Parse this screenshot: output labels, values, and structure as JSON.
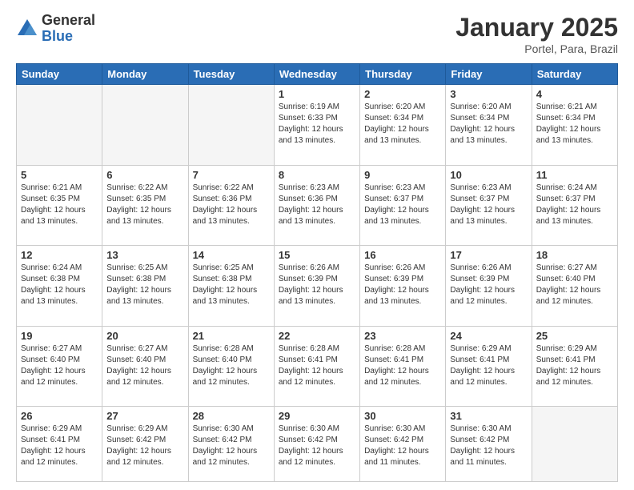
{
  "header": {
    "logo_general": "General",
    "logo_blue": "Blue",
    "month_title": "January 2025",
    "location": "Portel, Para, Brazil"
  },
  "weekdays": [
    "Sunday",
    "Monday",
    "Tuesday",
    "Wednesday",
    "Thursday",
    "Friday",
    "Saturday"
  ],
  "weeks": [
    [
      {
        "day": "",
        "info": ""
      },
      {
        "day": "",
        "info": ""
      },
      {
        "day": "",
        "info": ""
      },
      {
        "day": "1",
        "info": "Sunrise: 6:19 AM\nSunset: 6:33 PM\nDaylight: 12 hours\nand 13 minutes."
      },
      {
        "day": "2",
        "info": "Sunrise: 6:20 AM\nSunset: 6:34 PM\nDaylight: 12 hours\nand 13 minutes."
      },
      {
        "day": "3",
        "info": "Sunrise: 6:20 AM\nSunset: 6:34 PM\nDaylight: 12 hours\nand 13 minutes."
      },
      {
        "day": "4",
        "info": "Sunrise: 6:21 AM\nSunset: 6:34 PM\nDaylight: 12 hours\nand 13 minutes."
      }
    ],
    [
      {
        "day": "5",
        "info": "Sunrise: 6:21 AM\nSunset: 6:35 PM\nDaylight: 12 hours\nand 13 minutes."
      },
      {
        "day": "6",
        "info": "Sunrise: 6:22 AM\nSunset: 6:35 PM\nDaylight: 12 hours\nand 13 minutes."
      },
      {
        "day": "7",
        "info": "Sunrise: 6:22 AM\nSunset: 6:36 PM\nDaylight: 12 hours\nand 13 minutes."
      },
      {
        "day": "8",
        "info": "Sunrise: 6:23 AM\nSunset: 6:36 PM\nDaylight: 12 hours\nand 13 minutes."
      },
      {
        "day": "9",
        "info": "Sunrise: 6:23 AM\nSunset: 6:37 PM\nDaylight: 12 hours\nand 13 minutes."
      },
      {
        "day": "10",
        "info": "Sunrise: 6:23 AM\nSunset: 6:37 PM\nDaylight: 12 hours\nand 13 minutes."
      },
      {
        "day": "11",
        "info": "Sunrise: 6:24 AM\nSunset: 6:37 PM\nDaylight: 12 hours\nand 13 minutes."
      }
    ],
    [
      {
        "day": "12",
        "info": "Sunrise: 6:24 AM\nSunset: 6:38 PM\nDaylight: 12 hours\nand 13 minutes."
      },
      {
        "day": "13",
        "info": "Sunrise: 6:25 AM\nSunset: 6:38 PM\nDaylight: 12 hours\nand 13 minutes."
      },
      {
        "day": "14",
        "info": "Sunrise: 6:25 AM\nSunset: 6:38 PM\nDaylight: 12 hours\nand 13 minutes."
      },
      {
        "day": "15",
        "info": "Sunrise: 6:26 AM\nSunset: 6:39 PM\nDaylight: 12 hours\nand 13 minutes."
      },
      {
        "day": "16",
        "info": "Sunrise: 6:26 AM\nSunset: 6:39 PM\nDaylight: 12 hours\nand 13 minutes."
      },
      {
        "day": "17",
        "info": "Sunrise: 6:26 AM\nSunset: 6:39 PM\nDaylight: 12 hours\nand 12 minutes."
      },
      {
        "day": "18",
        "info": "Sunrise: 6:27 AM\nSunset: 6:40 PM\nDaylight: 12 hours\nand 12 minutes."
      }
    ],
    [
      {
        "day": "19",
        "info": "Sunrise: 6:27 AM\nSunset: 6:40 PM\nDaylight: 12 hours\nand 12 minutes."
      },
      {
        "day": "20",
        "info": "Sunrise: 6:27 AM\nSunset: 6:40 PM\nDaylight: 12 hours\nand 12 minutes."
      },
      {
        "day": "21",
        "info": "Sunrise: 6:28 AM\nSunset: 6:40 PM\nDaylight: 12 hours\nand 12 minutes."
      },
      {
        "day": "22",
        "info": "Sunrise: 6:28 AM\nSunset: 6:41 PM\nDaylight: 12 hours\nand 12 minutes."
      },
      {
        "day": "23",
        "info": "Sunrise: 6:28 AM\nSunset: 6:41 PM\nDaylight: 12 hours\nand 12 minutes."
      },
      {
        "day": "24",
        "info": "Sunrise: 6:29 AM\nSunset: 6:41 PM\nDaylight: 12 hours\nand 12 minutes."
      },
      {
        "day": "25",
        "info": "Sunrise: 6:29 AM\nSunset: 6:41 PM\nDaylight: 12 hours\nand 12 minutes."
      }
    ],
    [
      {
        "day": "26",
        "info": "Sunrise: 6:29 AM\nSunset: 6:41 PM\nDaylight: 12 hours\nand 12 minutes."
      },
      {
        "day": "27",
        "info": "Sunrise: 6:29 AM\nSunset: 6:42 PM\nDaylight: 12 hours\nand 12 minutes."
      },
      {
        "day": "28",
        "info": "Sunrise: 6:30 AM\nSunset: 6:42 PM\nDaylight: 12 hours\nand 12 minutes."
      },
      {
        "day": "29",
        "info": "Sunrise: 6:30 AM\nSunset: 6:42 PM\nDaylight: 12 hours\nand 12 minutes."
      },
      {
        "day": "30",
        "info": "Sunrise: 6:30 AM\nSunset: 6:42 PM\nDaylight: 12 hours\nand 11 minutes."
      },
      {
        "day": "31",
        "info": "Sunrise: 6:30 AM\nSunset: 6:42 PM\nDaylight: 12 hours\nand 11 minutes."
      },
      {
        "day": "",
        "info": ""
      }
    ]
  ]
}
